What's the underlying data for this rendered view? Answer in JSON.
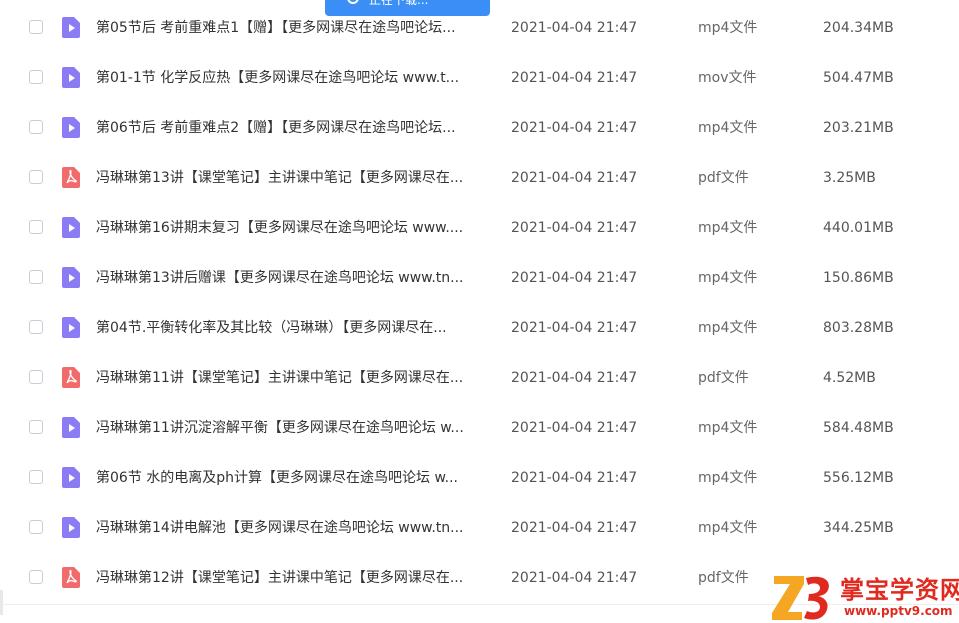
{
  "banner": {
    "text": "正在下载..."
  },
  "colors": {
    "video_icon": "#8b7cf6",
    "pdf_icon": "#f26b6b",
    "banner": "#3a8ef6",
    "watermark": "#e02a20"
  },
  "files": [
    {
      "name": "第05节后 考前重难点1【赠】【更多网课尽在途鸟吧论坛...",
      "date": "2021-04-04 21:47",
      "type": "mp4文件",
      "size": "204.34MB",
      "icon": "video-file-icon"
    },
    {
      "name": "第01-1节 化学反应热【更多网课尽在途鸟吧论坛 www.t...",
      "date": "2021-04-04 21:47",
      "type": "mov文件",
      "size": "504.47MB",
      "icon": "video-file-icon"
    },
    {
      "name": "第06节后 考前重难点2【赠】【更多网课尽在途鸟吧论坛...",
      "date": "2021-04-04 21:47",
      "type": "mp4文件",
      "size": "203.21MB",
      "icon": "video-file-icon"
    },
    {
      "name": "冯琳琳第13讲【课堂笔记】主讲课中笔记【更多网课尽在...",
      "date": "2021-04-04 21:47",
      "type": "pdf文件",
      "size": "3.25MB",
      "icon": "pdf-file-icon"
    },
    {
      "name": "冯琳琳第16讲期末复习【更多网课尽在途鸟吧论坛 www....",
      "date": "2021-04-04 21:47",
      "type": "mp4文件",
      "size": "440.01MB",
      "icon": "video-file-icon"
    },
    {
      "name": "冯琳琳第13讲后赠课【更多网课尽在途鸟吧论坛 www.tn...",
      "date": "2021-04-04 21:47",
      "type": "mp4文件",
      "size": "150.86MB",
      "icon": "video-file-icon"
    },
    {
      "name": "第04节.平衡转化率及其比较（冯琳琳）【更多网课尽在...",
      "date": "2021-04-04 21:47",
      "type": "mp4文件",
      "size": "803.28MB",
      "icon": "video-file-icon"
    },
    {
      "name": "冯琳琳第11讲【课堂笔记】主讲课中笔记【更多网课尽在...",
      "date": "2021-04-04 21:47",
      "type": "pdf文件",
      "size": "4.52MB",
      "icon": "pdf-file-icon"
    },
    {
      "name": "冯琳琳第11讲沉淀溶解平衡【更多网课尽在途鸟吧论坛 w...",
      "date": "2021-04-04 21:47",
      "type": "mp4文件",
      "size": "584.48MB",
      "icon": "video-file-icon"
    },
    {
      "name": "第06节 水的电离及ph计算【更多网课尽在途鸟吧论坛 w...",
      "date": "2021-04-04 21:47",
      "type": "mp4文件",
      "size": "556.12MB",
      "icon": "video-file-icon"
    },
    {
      "name": "冯琳琳第14讲电解池【更多网课尽在途鸟吧论坛 www.tn...",
      "date": "2021-04-04 21:47",
      "type": "mp4文件",
      "size": "344.25MB",
      "icon": "video-file-icon"
    },
    {
      "name": "冯琳琳第12讲【课堂笔记】主讲课中笔记【更多网课尽在...",
      "date": "2021-04-04 21:47",
      "type": "pdf文件",
      "size": "",
      "icon": "pdf-file-icon"
    }
  ],
  "watermark": {
    "title": "掌宝学资网",
    "url": "www.pptv9.com"
  }
}
